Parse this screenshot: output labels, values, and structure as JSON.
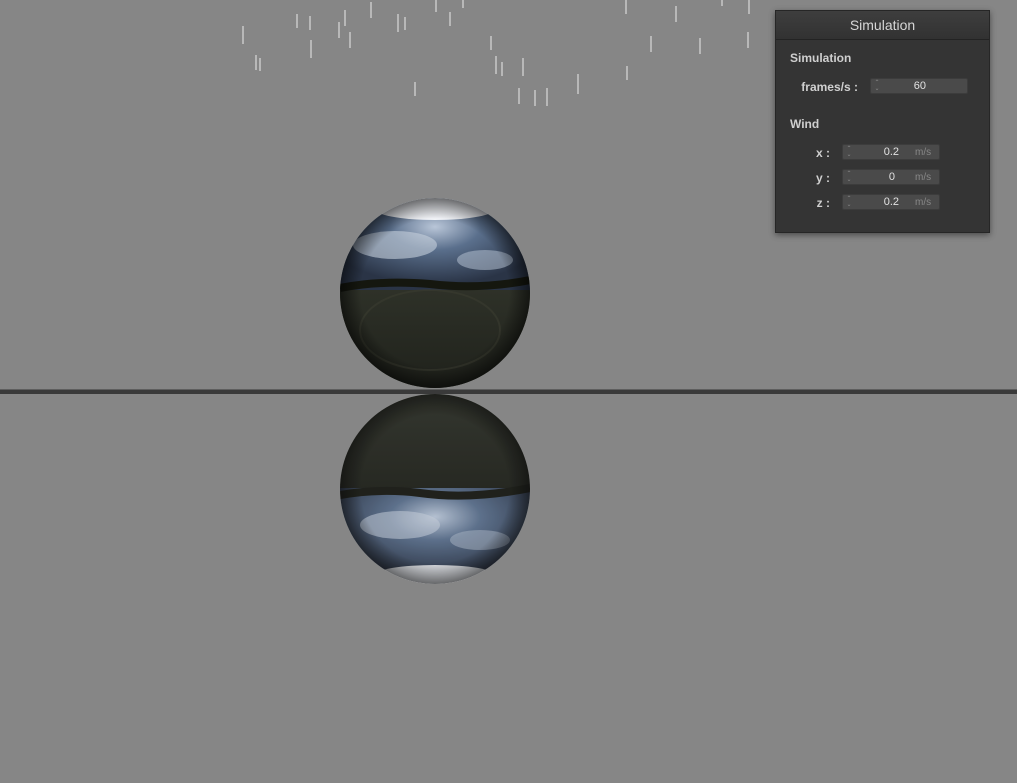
{
  "panel": {
    "title": "Simulation",
    "simulation_section": "Simulation",
    "frames_label": "frames/s :",
    "frames_value": "60",
    "wind_section": "Wind",
    "wind": [
      {
        "label": "x :",
        "value": "0.2",
        "unit": "m/s"
      },
      {
        "label": "y :",
        "value": "0",
        "unit": "m/s"
      },
      {
        "label": "z :",
        "value": "0.2",
        "unit": "m/s"
      }
    ]
  },
  "scene": {
    "background_color": "#868686",
    "objects": [
      "chrome-sphere",
      "ground-plane",
      "sphere-reflection",
      "rain-streaks"
    ]
  }
}
